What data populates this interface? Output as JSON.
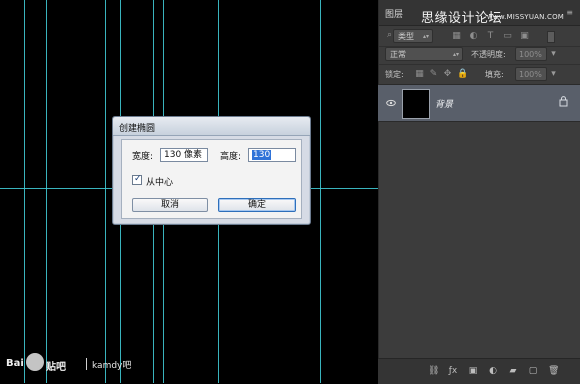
{
  "panel": {
    "title": "图层",
    "watermark": "思缘设计论坛",
    "watermark_url": "www.MISSYUAN.COM",
    "filter_kind": "类型",
    "blend_mode": "正常",
    "opacity_label": "不透明度:",
    "opacity_value": "100%",
    "lock_label": "锁定:",
    "fill_label": "填充:",
    "fill_value": "100%",
    "layer_name": "背景",
    "bottom_icons": [
      "link-icon",
      "fx-icon",
      "mask-icon",
      "adjustment-icon",
      "folder-icon",
      "new-layer-icon",
      "trash-icon"
    ]
  },
  "dialog": {
    "title": "创建椭圆",
    "width_label": "宽度:",
    "width_value": "130 像素",
    "height_label": "高度:",
    "height_value": "130",
    "checkbox_label": "从中心",
    "cancel": "取消",
    "ok": "确定"
  },
  "watermark_bottom": {
    "baidu": "Bai",
    "tieba": "贴吧",
    "user": "kamdy吧"
  }
}
